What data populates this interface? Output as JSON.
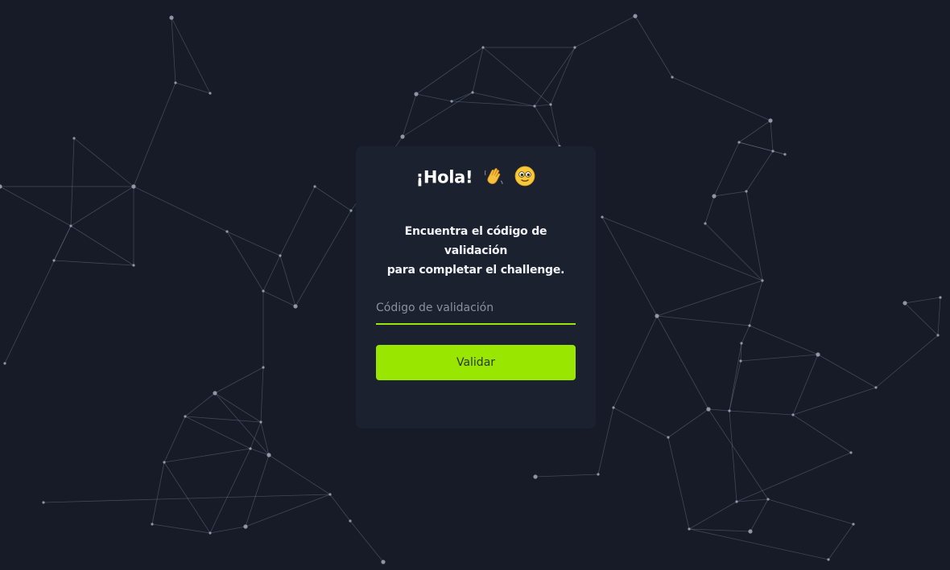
{
  "greeting": {
    "title": "¡Hola!",
    "wave_icon": "waving-hand-icon",
    "face_icon": "smiling-face-icon"
  },
  "form": {
    "subtitle_line1": "Encuentra el código de validación",
    "subtitle_line2": "para completar el challenge.",
    "input_placeholder": "Código de validación",
    "input_value": "",
    "button_label": "Validar"
  },
  "colors": {
    "background": "#161b27",
    "card": "#1c2130",
    "accent": "#99e600",
    "network_lines": "#8a90a0"
  }
}
